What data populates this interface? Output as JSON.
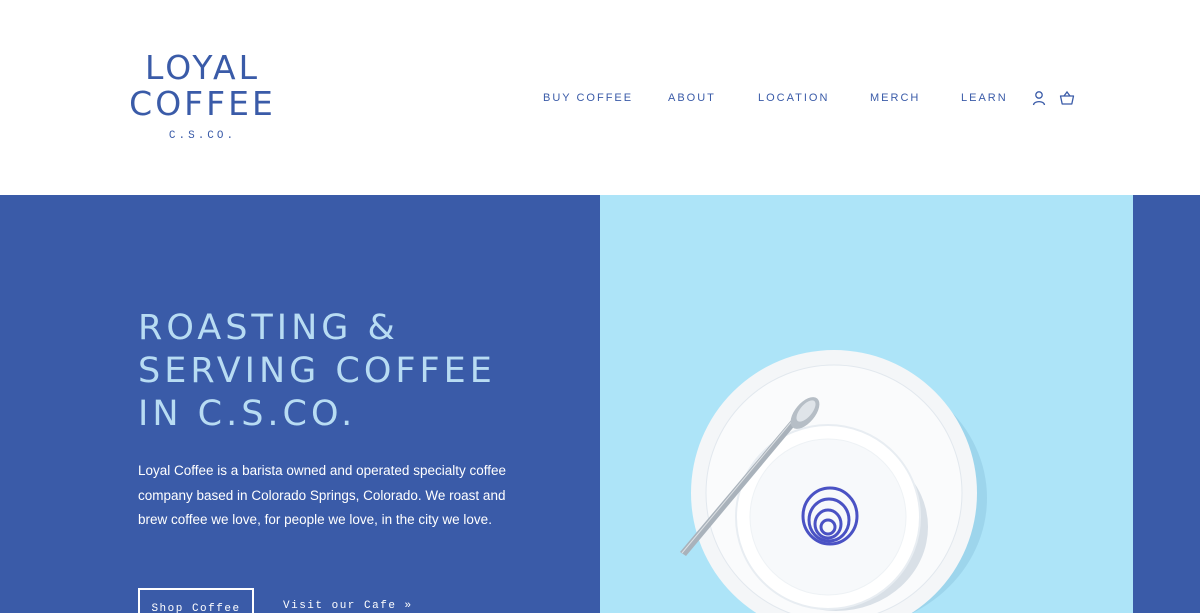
{
  "logo": {
    "line1": "LOYAL",
    "line2": "COFFEE",
    "line3": "C.S.CO."
  },
  "nav": {
    "items": [
      {
        "label": "BUY COFFEE"
      },
      {
        "label": "ABOUT"
      },
      {
        "label": "LOCATION"
      },
      {
        "label": "MERCH"
      },
      {
        "label": "LEARN"
      }
    ],
    "icons": [
      "user-icon",
      "cart-icon"
    ]
  },
  "hero": {
    "headline": [
      "ROASTING &",
      "SERVING COFFEE",
      "IN C.S.CO."
    ],
    "description": "Loyal Coffee is a barista owned and operated specialty coffee company based in Colorado Springs, Colorado. We roast and brew coffee we love, for people we love, in the city we love.",
    "primary_button": "Shop Coffee",
    "secondary_link": "Visit our Cafe »",
    "image_icon": "coffee-cup-icon"
  },
  "colors": {
    "brand_blue": "#3a5ba8",
    "headline_light_blue": "#b8dcf3",
    "image_background": "#ade4f8",
    "white": "#ffffff"
  }
}
